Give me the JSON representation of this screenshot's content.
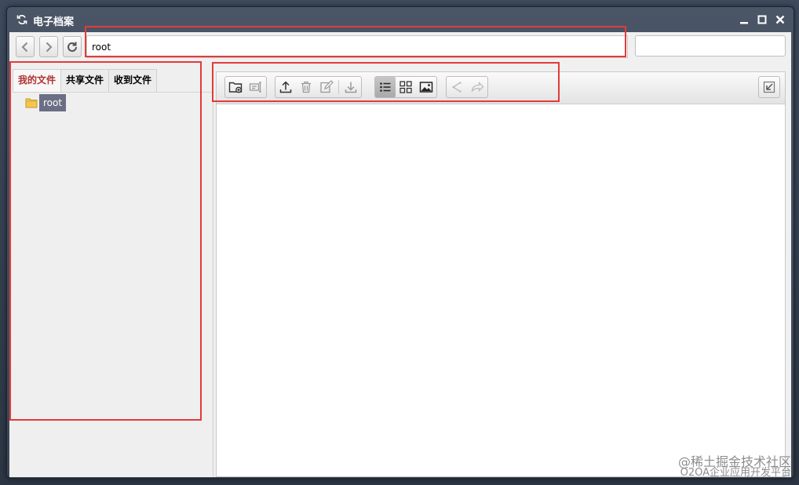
{
  "window": {
    "title": "电子档案"
  },
  "addressbar": {
    "path_value": "root",
    "search_value": ""
  },
  "left": {
    "tabs": [
      {
        "label": "我的文件",
        "active": true
      },
      {
        "label": "共享文件",
        "active": false
      },
      {
        "label": "收到文件",
        "active": false
      }
    ],
    "tree": [
      {
        "label": "root"
      }
    ]
  },
  "toolbar": {
    "groups": [
      [
        "new-folder-icon",
        "rename-icon"
      ],
      [
        "upload-icon",
        "trash-icon",
        "edit-icon",
        "download-icon"
      ],
      [
        "list-view-icon",
        "grid-view-icon",
        "image-view-icon"
      ],
      [
        "share-icon",
        "forward-icon"
      ]
    ],
    "active_view": "list-view-icon"
  },
  "watermark": {
    "line1": "@稀土掘金技术社区",
    "line2": "O2OA企业应用开发平台"
  },
  "colors": {
    "active_tab_text": "#b13131",
    "highlight_box": "#e23b3b",
    "selected_node_bg": "#6b6e84"
  }
}
